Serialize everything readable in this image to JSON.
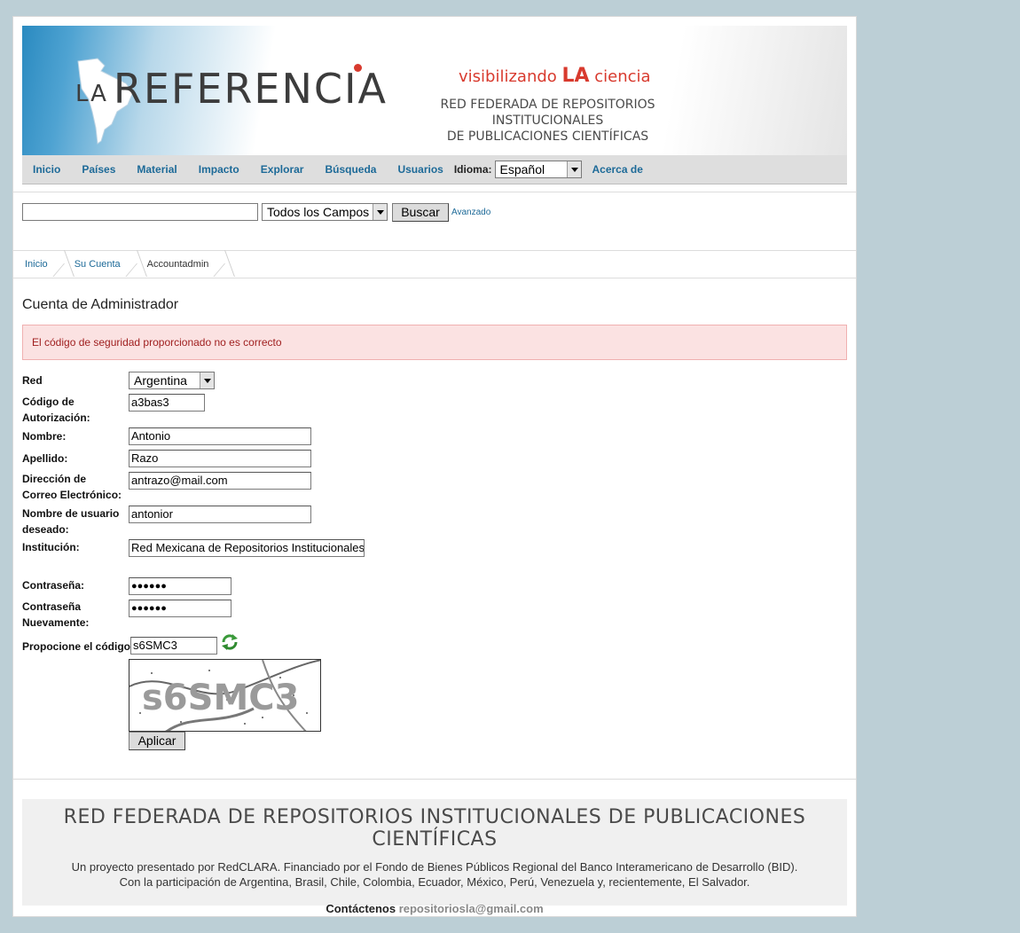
{
  "header": {
    "logo_small": "LA",
    "logo_main": "REFERENCIA",
    "tagline_pre": "visibilizando ",
    "tagline_la": "LA",
    "tagline_post": " ciencia",
    "subtitle_line1": "RED FEDERADA DE REPOSITORIOS INSTITUCIONALES",
    "subtitle_line2": "DE PUBLICACIONES CIENTÍFICAS"
  },
  "nav": {
    "items": [
      "Inicio",
      "Países",
      "Material",
      "Impacto",
      "Explorar",
      "Búsqueda",
      "Usuarios"
    ],
    "language_label": "Idioma:",
    "language_value": "Español",
    "about": "Acerca de"
  },
  "search": {
    "query": "",
    "field_value": "Todos los Campos",
    "button": "Buscar",
    "advanced": "Avanzado"
  },
  "breadcrumb": [
    "Inicio",
    "Su Cuenta",
    "Accountadmin"
  ],
  "page_title": "Cuenta de Administrador",
  "alert": "El código de seguridad proporcionado no es correcto",
  "form": {
    "red_label": "Red",
    "red_value": "Argentina",
    "auth_label_1": "Código de",
    "auth_label_2": "Autorización:",
    "auth_value": "a3bas3",
    "nombre_label": "Nombre:",
    "nombre_value": "Antonio",
    "apellido_label": "Apellido:",
    "apellido_value": "Razo",
    "email_label_1": "Dirección de",
    "email_label_2": "Correo Electrónico:",
    "email_value": "antrazo@mail.com",
    "user_label_1": "Nombre de usuario",
    "user_label_2": "deseado:",
    "user_value": "antonior",
    "inst_label": "Institución:",
    "inst_value": "Red Mexicana de Repositorios Institucionales",
    "pass_label": "Contraseña:",
    "pass_value": "●●●●●●",
    "pass2_label_1": "Contraseña",
    "pass2_label_2": "Nuevamente:",
    "pass2_value": "●●●●●●",
    "code_label": "Propocione el código:",
    "code_value": "s6SMC3",
    "captcha_text": "s6SMC3",
    "submit": "Aplicar"
  },
  "footer": {
    "title": "RED FEDERADA DE REPOSITORIOS INSTITUCIONALES DE PUBLICACIONES CIENTÍFICAS",
    "line1": "Un proyecto presentado por RedCLARA. Financiado por el Fondo de Bienes Públicos Regional del Banco Interamericano de Desarrollo (BID).",
    "line2": "Con la participación de Argentina, Brasil, Chile, Colombia, Ecuador, México, Perú, Venezuela y, recientemente, El Salvador.",
    "contact_label": "Contáctenos",
    "contact_email": "repositoriosla@gmail.com"
  }
}
